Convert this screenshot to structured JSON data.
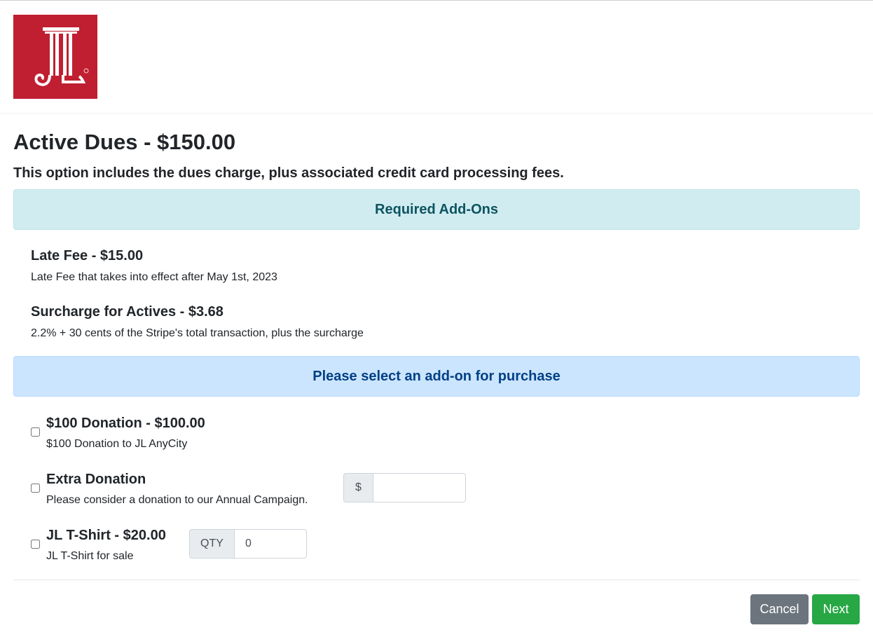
{
  "brand": {
    "logo_icon": "jl-column-logo",
    "logo_color": "#c01f31"
  },
  "page": {
    "title": "Active Dues - $150.00",
    "subtitle": "This option includes the dues charge, plus associated credit card processing fees."
  },
  "required_addons": {
    "heading": "Required Add-Ons",
    "items": [
      {
        "title": "Late Fee - $15.00",
        "description": "Late Fee that takes into effect after May 1st, 2023"
      },
      {
        "title": "Surcharge for Actives - $3.68",
        "description": "2.2% + 30 cents of the Stripe's total transaction, plus the surcharge"
      }
    ]
  },
  "optional_addons": {
    "heading": "Please select an add-on for purchase",
    "items": [
      {
        "title": "$100 Donation - $100.00",
        "description": "$100 Donation to JL AnyCity",
        "checked": false
      },
      {
        "title": "Extra Donation",
        "description": "Please consider a donation to our Annual Campaign.",
        "checked": false,
        "prefix": "$",
        "value": ""
      },
      {
        "title": "JL T-Shirt - $20.00",
        "description": "JL T-Shirt for sale",
        "checked": false,
        "prefix": "QTY",
        "value": "0"
      }
    ]
  },
  "actions": {
    "cancel_label": "Cancel",
    "next_label": "Next"
  },
  "colors": {
    "info_banner": "#d1ecf1",
    "primary_banner": "#cce5ff",
    "cancel_button": "#6c757d",
    "next_button": "#28a745"
  }
}
